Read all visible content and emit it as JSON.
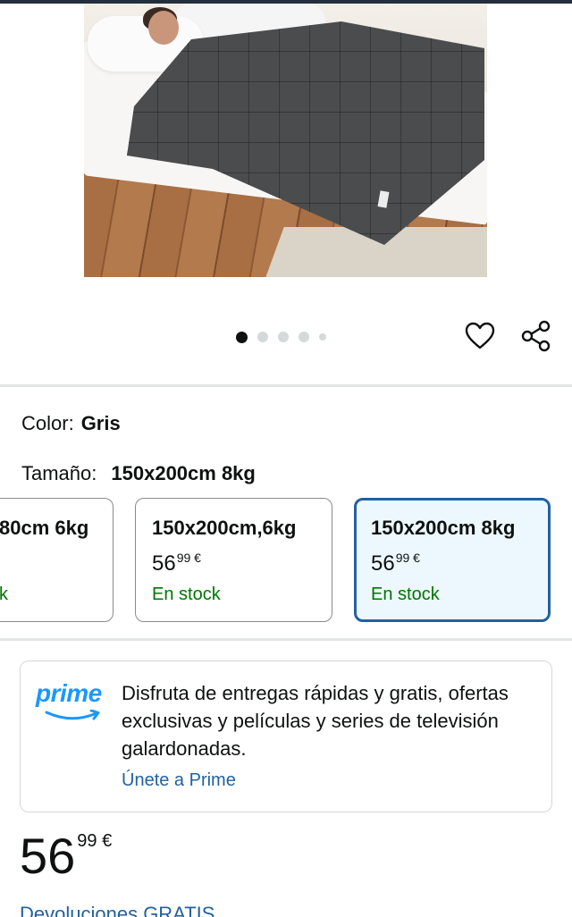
{
  "product_image": {
    "alt": "Manta con peso gris sobre cama"
  },
  "carousel": {
    "total": 5,
    "active_index": 0
  },
  "actions": {
    "favorite_icon": "heart-icon",
    "share_icon": "share-icon"
  },
  "color": {
    "label": "Color:",
    "value": "Gris"
  },
  "size": {
    "label": "Tamaño:",
    "value": "150x200cm 8kg"
  },
  "size_options": [
    {
      "name": "80cm 6kg",
      "price_whole": "",
      "price_fraction": "",
      "currency": "",
      "stock": "k"
    },
    {
      "name": "150x200cm,6kg",
      "price_whole": "56",
      "price_fraction": "99",
      "currency": "€",
      "stock": "En stock"
    },
    {
      "name": "150x200cm 8kg",
      "price_whole": "56",
      "price_fraction": "99",
      "currency": "€",
      "stock": "En stock",
      "selected": true
    }
  ],
  "prime": {
    "logo_text": "prime",
    "description": "Disfruta de entregas rápidas y gratis, ofertas exclusivas y películas y series de televisión galardonadas.",
    "cta": "Únete a Prime"
  },
  "price": {
    "whole": "56",
    "fraction": "99",
    "currency": "€"
  },
  "returns": {
    "label": "Devoluciones GRATIS"
  },
  "colors": {
    "link": "#2162a1",
    "in_stock": "#007600",
    "selected_border": "#2162a1",
    "prime_blue": "#1a98ff"
  }
}
